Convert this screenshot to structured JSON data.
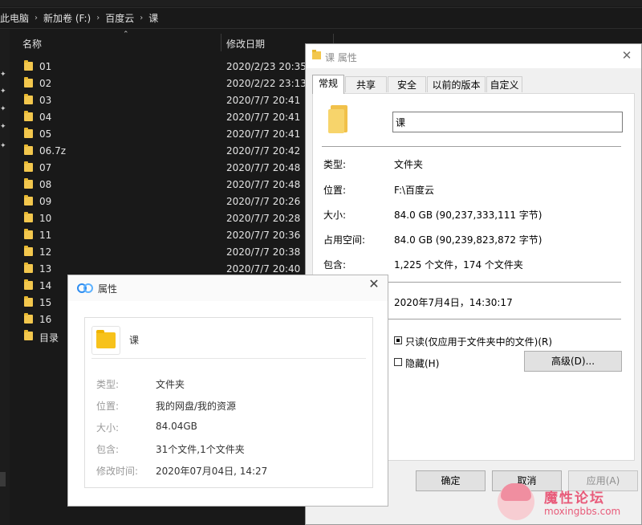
{
  "explorer": {
    "breadcrumb": [
      "此电脑",
      "新加卷 (F:)",
      "百度云",
      "课"
    ],
    "columns": {
      "name": "名称",
      "modified": "修改日期"
    },
    "files": [
      {
        "name": "01",
        "modified": "2020/2/23 20:35"
      },
      {
        "name": "02",
        "modified": "2020/2/22 23:13"
      },
      {
        "name": "03",
        "modified": "2020/7/7 20:41"
      },
      {
        "name": "04",
        "modified": "2020/7/7 20:41"
      },
      {
        "name": "05",
        "modified": "2020/7/7 20:41"
      },
      {
        "name": "06.7z",
        "modified": "2020/7/7 20:42"
      },
      {
        "name": "07",
        "modified": "2020/7/7 20:48"
      },
      {
        "name": "08",
        "modified": "2020/7/7 20:48"
      },
      {
        "name": "09",
        "modified": "2020/7/7 20:26"
      },
      {
        "name": "10",
        "modified": "2020/7/7 20:28"
      },
      {
        "name": "11",
        "modified": "2020/7/7 20:36"
      },
      {
        "name": "12",
        "modified": "2020/7/7 20:38"
      },
      {
        "name": "13",
        "modified": "2020/7/7 20:40"
      },
      {
        "name": "14",
        "modified": ""
      },
      {
        "name": "15",
        "modified": ""
      },
      {
        "name": "16",
        "modified": ""
      },
      {
        "name": "目录",
        "modified": ""
      }
    ]
  },
  "win_props": {
    "title": "课 属性",
    "tabs": [
      "常规",
      "共享",
      "安全",
      "以前的版本",
      "自定义"
    ],
    "name_value": "课",
    "type_label": "类型:",
    "type_value": "文件夹",
    "location_label": "位置:",
    "location_value": "F:\\百度云",
    "size_label": "大小:",
    "size_value": "84.0 GB (90,237,333,111 字节)",
    "disk_label": "占用空间:",
    "disk_value": "84.0 GB (90,239,823,872 字节)",
    "contains_label": "包含:",
    "contains_value": "1,225 个文件，174 个文件夹",
    "created_value": "2020年7月4日，14:30:17",
    "readonly_label": "只读(仅应用于文件夹中的文件)(R)",
    "hidden_label": "隐藏(H)",
    "advanced_button": "高级(D)...",
    "ok_button": "确定",
    "cancel_button": "取消",
    "apply_button": "应用(A)"
  },
  "baidu_props": {
    "title": "属性",
    "folder_name": "课",
    "type_label": "类型:",
    "type_value": "文件夹",
    "location_label": "位置:",
    "location_value": "我的网盘/我的资源",
    "size_label": "大小:",
    "size_value": "84.04GB",
    "contains_label": "包含:",
    "contains_value": "31个文件,1个文件夹",
    "modified_label": "修改时间:",
    "modified_value": "2020年07月04日, 14:27"
  },
  "watermark": {
    "title": "魔性论坛",
    "url": "moxingbbs.com"
  },
  "colors": {
    "explorer_bg": "#191919",
    "folder": "#f3c74d",
    "baidu_folder": "#f7c21b",
    "watermark": "#e85b7a"
  }
}
